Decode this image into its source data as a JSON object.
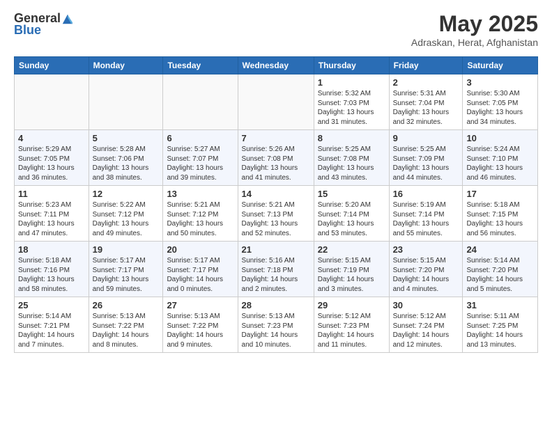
{
  "header": {
    "logo_general": "General",
    "logo_blue": "Blue",
    "month_title": "May 2025",
    "location": "Adraskan, Herat, Afghanistan"
  },
  "days_of_week": [
    "Sunday",
    "Monday",
    "Tuesday",
    "Wednesday",
    "Thursday",
    "Friday",
    "Saturday"
  ],
  "weeks": [
    [
      {
        "day": "",
        "info": ""
      },
      {
        "day": "",
        "info": ""
      },
      {
        "day": "",
        "info": ""
      },
      {
        "day": "",
        "info": ""
      },
      {
        "day": "1",
        "info": "Sunrise: 5:32 AM\nSunset: 7:03 PM\nDaylight: 13 hours\nand 31 minutes."
      },
      {
        "day": "2",
        "info": "Sunrise: 5:31 AM\nSunset: 7:04 PM\nDaylight: 13 hours\nand 32 minutes."
      },
      {
        "day": "3",
        "info": "Sunrise: 5:30 AM\nSunset: 7:05 PM\nDaylight: 13 hours\nand 34 minutes."
      }
    ],
    [
      {
        "day": "4",
        "info": "Sunrise: 5:29 AM\nSunset: 7:05 PM\nDaylight: 13 hours\nand 36 minutes."
      },
      {
        "day": "5",
        "info": "Sunrise: 5:28 AM\nSunset: 7:06 PM\nDaylight: 13 hours\nand 38 minutes."
      },
      {
        "day": "6",
        "info": "Sunrise: 5:27 AM\nSunset: 7:07 PM\nDaylight: 13 hours\nand 39 minutes."
      },
      {
        "day": "7",
        "info": "Sunrise: 5:26 AM\nSunset: 7:08 PM\nDaylight: 13 hours\nand 41 minutes."
      },
      {
        "day": "8",
        "info": "Sunrise: 5:25 AM\nSunset: 7:08 PM\nDaylight: 13 hours\nand 43 minutes."
      },
      {
        "day": "9",
        "info": "Sunrise: 5:25 AM\nSunset: 7:09 PM\nDaylight: 13 hours\nand 44 minutes."
      },
      {
        "day": "10",
        "info": "Sunrise: 5:24 AM\nSunset: 7:10 PM\nDaylight: 13 hours\nand 46 minutes."
      }
    ],
    [
      {
        "day": "11",
        "info": "Sunrise: 5:23 AM\nSunset: 7:11 PM\nDaylight: 13 hours\nand 47 minutes."
      },
      {
        "day": "12",
        "info": "Sunrise: 5:22 AM\nSunset: 7:12 PM\nDaylight: 13 hours\nand 49 minutes."
      },
      {
        "day": "13",
        "info": "Sunrise: 5:21 AM\nSunset: 7:12 PM\nDaylight: 13 hours\nand 50 minutes."
      },
      {
        "day": "14",
        "info": "Sunrise: 5:21 AM\nSunset: 7:13 PM\nDaylight: 13 hours\nand 52 minutes."
      },
      {
        "day": "15",
        "info": "Sunrise: 5:20 AM\nSunset: 7:14 PM\nDaylight: 13 hours\nand 53 minutes."
      },
      {
        "day": "16",
        "info": "Sunrise: 5:19 AM\nSunset: 7:14 PM\nDaylight: 13 hours\nand 55 minutes."
      },
      {
        "day": "17",
        "info": "Sunrise: 5:18 AM\nSunset: 7:15 PM\nDaylight: 13 hours\nand 56 minutes."
      }
    ],
    [
      {
        "day": "18",
        "info": "Sunrise: 5:18 AM\nSunset: 7:16 PM\nDaylight: 13 hours\nand 58 minutes."
      },
      {
        "day": "19",
        "info": "Sunrise: 5:17 AM\nSunset: 7:17 PM\nDaylight: 13 hours\nand 59 minutes."
      },
      {
        "day": "20",
        "info": "Sunrise: 5:17 AM\nSunset: 7:17 PM\nDaylight: 14 hours\nand 0 minutes."
      },
      {
        "day": "21",
        "info": "Sunrise: 5:16 AM\nSunset: 7:18 PM\nDaylight: 14 hours\nand 2 minutes."
      },
      {
        "day": "22",
        "info": "Sunrise: 5:15 AM\nSunset: 7:19 PM\nDaylight: 14 hours\nand 3 minutes."
      },
      {
        "day": "23",
        "info": "Sunrise: 5:15 AM\nSunset: 7:20 PM\nDaylight: 14 hours\nand 4 minutes."
      },
      {
        "day": "24",
        "info": "Sunrise: 5:14 AM\nSunset: 7:20 PM\nDaylight: 14 hours\nand 5 minutes."
      }
    ],
    [
      {
        "day": "25",
        "info": "Sunrise: 5:14 AM\nSunset: 7:21 PM\nDaylight: 14 hours\nand 7 minutes."
      },
      {
        "day": "26",
        "info": "Sunrise: 5:13 AM\nSunset: 7:22 PM\nDaylight: 14 hours\nand 8 minutes."
      },
      {
        "day": "27",
        "info": "Sunrise: 5:13 AM\nSunset: 7:22 PM\nDaylight: 14 hours\nand 9 minutes."
      },
      {
        "day": "28",
        "info": "Sunrise: 5:13 AM\nSunset: 7:23 PM\nDaylight: 14 hours\nand 10 minutes."
      },
      {
        "day": "29",
        "info": "Sunrise: 5:12 AM\nSunset: 7:23 PM\nDaylight: 14 hours\nand 11 minutes."
      },
      {
        "day": "30",
        "info": "Sunrise: 5:12 AM\nSunset: 7:24 PM\nDaylight: 14 hours\nand 12 minutes."
      },
      {
        "day": "31",
        "info": "Sunrise: 5:11 AM\nSunset: 7:25 PM\nDaylight: 14 hours\nand 13 minutes."
      }
    ]
  ]
}
